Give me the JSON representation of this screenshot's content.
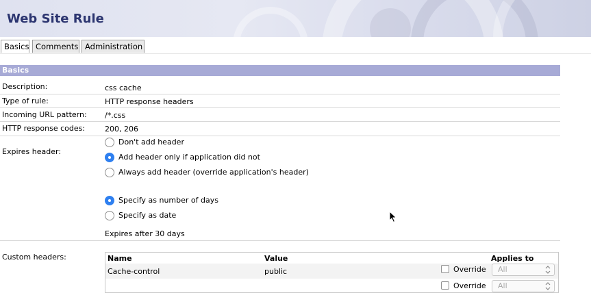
{
  "header": {
    "title": "Web Site Rule"
  },
  "tabs": [
    {
      "label": "Basics",
      "active": true
    },
    {
      "label": "Comments",
      "active": false
    },
    {
      "label": "Administration",
      "active": false
    }
  ],
  "section": {
    "title": "Basics"
  },
  "fields": {
    "description": {
      "label": "Description:",
      "value": "css cache"
    },
    "rule_type": {
      "label": "Type of rule:",
      "value": "HTTP response headers"
    },
    "url_pattern": {
      "label": "Incoming URL pattern:",
      "value": "/*.css"
    },
    "response_codes": {
      "label": "HTTP response codes:",
      "value": "200, 206"
    }
  },
  "expires": {
    "label": "Expires header:",
    "header_options": [
      {
        "label": "Don't add header",
        "checked": false
      },
      {
        "label": "Add header only if application did not",
        "checked": true
      },
      {
        "label": "Always add header (override application's header)",
        "checked": false
      }
    ],
    "mode_options": [
      {
        "label": "Specify as number of days",
        "checked": true
      },
      {
        "label": "Specify as date",
        "checked": false
      }
    ],
    "summary": "Expires after 30 days"
  },
  "custom_headers": {
    "label": "Custom headers:",
    "columns": {
      "name": "Name",
      "value": "Value",
      "applies_to": "Applies to"
    },
    "rows": [
      {
        "name": "Cache-control",
        "value": "public",
        "override_label": "Override",
        "override": false,
        "applies_to": "All"
      },
      {
        "name": "",
        "value": "",
        "override_label": "Override",
        "override": false,
        "applies_to": "All"
      }
    ]
  },
  "colors": {
    "title": "#2c3570",
    "section_bar": "#a7aad6",
    "radio_selected": "#2f80f0"
  }
}
